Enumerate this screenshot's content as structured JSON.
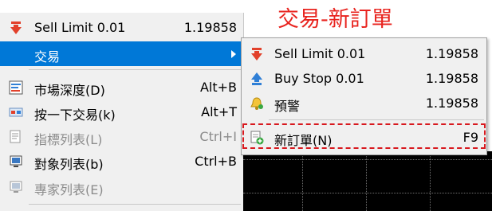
{
  "annotation_text": "交易-新訂單",
  "left_menu": {
    "items": [
      {
        "label": "Sell Limit 0.01",
        "value": "1.19858",
        "icon": "arrow-down-icon"
      },
      {
        "label": "交易",
        "icon": "submenu-arrow-icon"
      },
      {
        "label": "市場深度(D)",
        "shortcut": "Alt+B",
        "icon": "market-depth-icon"
      },
      {
        "label": "按一下交易(k)",
        "shortcut": "Alt+T",
        "icon": "one-click-trading-icon"
      },
      {
        "label": "指標列表(L)",
        "shortcut": "Ctrl+I",
        "icon": "indicator-list-icon"
      },
      {
        "label": "對象列表(b)",
        "shortcut": "Ctrl+B",
        "icon": "object-list-icon"
      },
      {
        "label": "專家列表(E)",
        "icon": "expert-list-icon"
      }
    ]
  },
  "submenu": {
    "items": [
      {
        "label": "Sell Limit 0.01",
        "value": "1.19858",
        "icon": "arrow-down-icon"
      },
      {
        "label": "Buy Stop 0.01",
        "value": "1.19858",
        "icon": "arrow-up-icon"
      },
      {
        "label": "預警",
        "value": "1.19858",
        "icon": "alert-bell-icon"
      },
      {
        "label": "新訂單(N)",
        "value": "F9",
        "icon": "new-order-icon"
      }
    ]
  },
  "colors": {
    "highlight": "#0078d7",
    "annotation": "#e8231e",
    "arrow_down": "#e2412b",
    "arrow_up": "#2f7fd6"
  }
}
